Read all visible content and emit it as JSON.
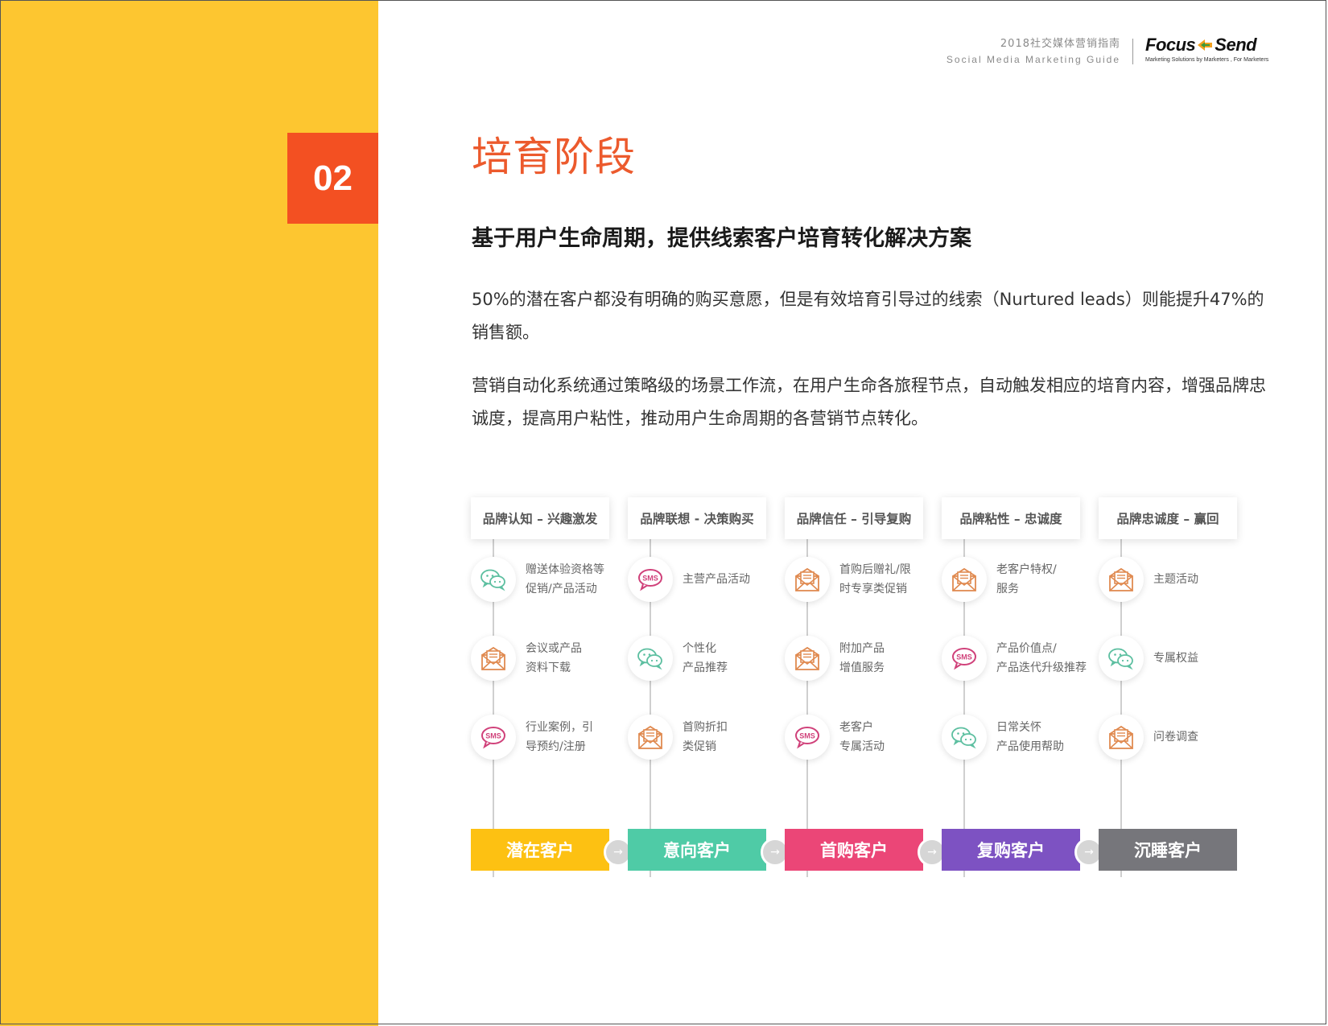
{
  "header": {
    "guide_cn": "2018社交媒体营销指南",
    "guide_en": "Social Media Marketing Guide",
    "brand_left": "Focus",
    "brand_right": "Send",
    "brand_tagline": "Marketing Solutions by Marketers , For Marketers"
  },
  "section": {
    "number": "02",
    "title": "培育阶段"
  },
  "subtitle": "基于用户生命周期，提供线索客户培育转化解决方案",
  "paragraphs": [
    "50%的潜在客户都没有明确的购买意愿，但是有效培育引导过的线索（Nurtured leads）则能提升47%的销售额。",
    "营销自动化系统通过策略级的场景工作流，在用户生命各旅程节点，自动触发相应的培育内容，增强品牌忠诚度，提高用户粘性，推动用户生命周期的各营销节点转化。"
  ],
  "colors": {
    "sidebar": "#fdc630",
    "accent": "#f35022",
    "title": "#ec5a2d",
    "stage_1": "#fdc112",
    "stage_2": "#4fcba6",
    "stage_3": "#eb4677",
    "stage_4": "#7d52c2",
    "stage_5": "#76767b"
  },
  "columns": [
    {
      "header": "品牌认知 – 兴趣激发",
      "stage": "潜在客户",
      "items": [
        {
          "icon": "wechat-icon",
          "line1": "赠送体验资格等",
          "line2": "促销/产品活动"
        },
        {
          "icon": "email-icon",
          "line1": "会议或产品",
          "line2": "资料下载"
        },
        {
          "icon": "sms-icon",
          "line1": "行业案例，引",
          "line2": "导预约/注册"
        }
      ]
    },
    {
      "header": "品牌联想 - 决策购买",
      "stage": "意向客户",
      "items": [
        {
          "icon": "sms-icon",
          "line1": "主营产品活动",
          "line2": ""
        },
        {
          "icon": "wechat-icon",
          "line1": "个性化",
          "line2": "产品推荐"
        },
        {
          "icon": "email-icon",
          "line1": "首购折扣",
          "line2": "类促销"
        }
      ]
    },
    {
      "header": "品牌信任 – 引导复购",
      "stage": "首购客户",
      "items": [
        {
          "icon": "email-icon",
          "line1": "首购后赠礼/限",
          "line2": "时专享类促销"
        },
        {
          "icon": "email-icon",
          "line1": "附加产品",
          "line2": "增值服务"
        },
        {
          "icon": "sms-icon",
          "line1": "老客户",
          "line2": "专属活动"
        }
      ]
    },
    {
      "header": "品牌粘性 – 忠诚度",
      "stage": "复购客户",
      "items": [
        {
          "icon": "email-icon",
          "line1": "老客户特权/",
          "line2": "服务"
        },
        {
          "icon": "sms-icon",
          "line1": "产品价值点/",
          "line2": "产品迭代升级推荐"
        },
        {
          "icon": "wechat-icon",
          "line1": "日常关怀",
          "line2": "产品使用帮助"
        }
      ]
    },
    {
      "header": "品牌忠诚度 – 赢回",
      "stage": "沉睡客户",
      "items": [
        {
          "icon": "email-icon",
          "line1": "主题活动",
          "line2": ""
        },
        {
          "icon": "wechat-icon",
          "line1": "专属权益",
          "line2": ""
        },
        {
          "icon": "email-icon",
          "line1": "问卷调查",
          "line2": ""
        }
      ]
    }
  ],
  "arrow_symbol": "→"
}
